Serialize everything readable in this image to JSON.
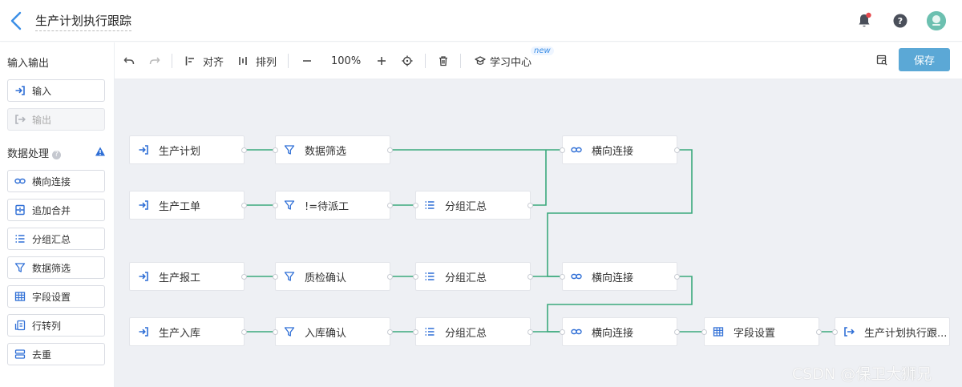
{
  "header": {
    "title": "生产计划执行跟踪"
  },
  "sidebar": {
    "io_title": "输入输出",
    "input_label": "输入",
    "output_label": "输出",
    "processing_title": "数据处理",
    "help_mark": "?",
    "items": [
      {
        "label": "横向连接",
        "icon": "link-icon"
      },
      {
        "label": "追加合并",
        "icon": "merge-icon"
      },
      {
        "label": "分组汇总",
        "icon": "list-icon"
      },
      {
        "label": "数据筛选",
        "icon": "filter-icon"
      },
      {
        "label": "字段设置",
        "icon": "table-icon"
      },
      {
        "label": "行转列",
        "icon": "pivot-icon"
      },
      {
        "label": "去重",
        "icon": "dedup-icon"
      }
    ]
  },
  "toolbar": {
    "align_label": "对齐",
    "arrange_label": "排列",
    "zoom_level": "100%",
    "learning_center_label": "学习中心",
    "new_badge": "new",
    "save_label": "保存"
  },
  "canvas": {
    "nodes": [
      {
        "id": "n1",
        "label": "生产计划",
        "type": "input"
      },
      {
        "id": "n2",
        "label": "数据筛选",
        "type": "filter"
      },
      {
        "id": "n3",
        "label": "横向连接",
        "type": "join"
      },
      {
        "id": "n4",
        "label": "生产工单",
        "type": "input"
      },
      {
        "id": "n5",
        "label": "!=待派工",
        "type": "filter"
      },
      {
        "id": "n6",
        "label": "分组汇总",
        "type": "group"
      },
      {
        "id": "n7",
        "label": "生产报工",
        "type": "input"
      },
      {
        "id": "n8",
        "label": "质检确认",
        "type": "filter"
      },
      {
        "id": "n9",
        "label": "分组汇总",
        "type": "group"
      },
      {
        "id": "n10",
        "label": "横向连接",
        "type": "join"
      },
      {
        "id": "n11",
        "label": "生产入库",
        "type": "input"
      },
      {
        "id": "n12",
        "label": "入库确认",
        "type": "filter"
      },
      {
        "id": "n13",
        "label": "分组汇总",
        "type": "group"
      },
      {
        "id": "n14",
        "label": "横向连接",
        "type": "join"
      },
      {
        "id": "n15",
        "label": "字段设置",
        "type": "fields"
      },
      {
        "id": "n16",
        "label": "生产计划执行跟...",
        "type": "output"
      }
    ],
    "edge_color": "#3aa97c"
  },
  "watermark": "CSDN @保卫大狮兄",
  "colors": {
    "primary": "#5ba8d6",
    "icon_blue": "#3a7bd5",
    "warning": "#2f6fd6",
    "notification_dot": "#e5484d"
  }
}
